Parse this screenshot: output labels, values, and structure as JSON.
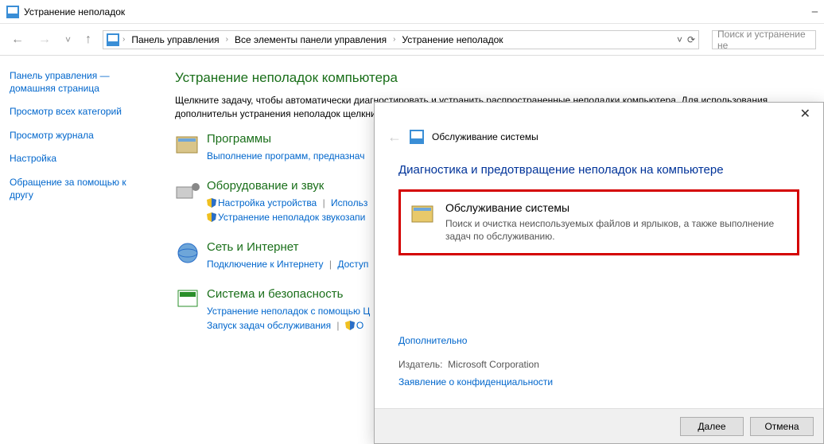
{
  "titlebar": {
    "title": "Устранение неполадок"
  },
  "breadcrumbs": {
    "b0": "Панель управления",
    "b1": "Все элементы панели управления",
    "b2": "Устранение неполадок"
  },
  "search": {
    "placeholder": "Поиск и устранение не"
  },
  "sidebar": {
    "i0": "Панель управления — домашняя страница",
    "i1": "Просмотр всех категорий",
    "i2": "Просмотр журнала",
    "i3": "Настройка",
    "i4": "Обращение за помощью к другу"
  },
  "content": {
    "heading": "Устранение неполадок компьютера",
    "desc": "Щелкните задачу, чтобы автоматически диагностировать и устранить распространенные неполадки компьютера. Для использования дополнительн устранения неполадок щелкните категорию",
    "cat0": {
      "title": "Программы",
      "l0": "Выполнение программ, предназнач"
    },
    "cat1": {
      "title": "Оборудование и звук",
      "l0": "Настройка устройства",
      "l1": "Использ",
      "l2": "Устранение неполадок звукозапи"
    },
    "cat2": {
      "title": "Сеть и Интернет",
      "l0": "Подключение к Интернету",
      "l1": "Доступ"
    },
    "cat3": {
      "title": "Система и безопасность",
      "l0": "Устранение неполадок с помощью Ц",
      "l1": "Запуск задач обслуживания",
      "l2": "О"
    }
  },
  "dialog": {
    "head": "Обслуживание системы",
    "h1": "Диагностика и предотвращение неполадок на компьютере",
    "item_title": "Обслуживание системы",
    "item_desc": "Поиск и очистка неиспользуемых файлов и ярлыков, а также выполнение задач по обслуживанию.",
    "more": "Дополнительно",
    "publisher_label": "Издатель:",
    "publisher": "Microsoft Corporation",
    "privacy": "Заявление о конфиденциальности",
    "next": "Далее",
    "cancel": "Отмена"
  }
}
